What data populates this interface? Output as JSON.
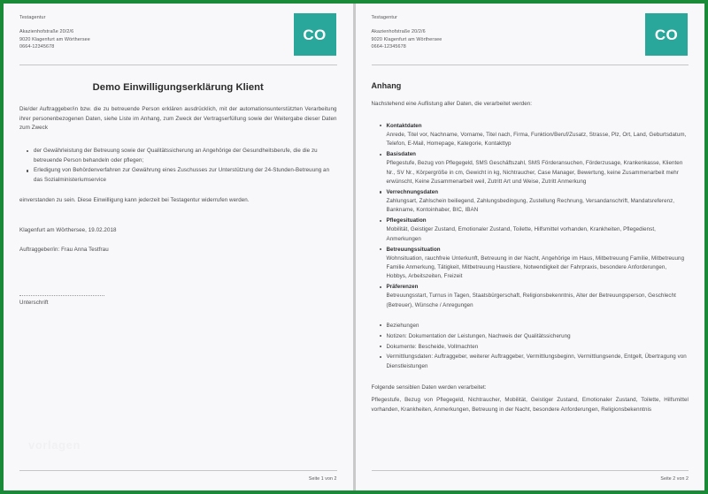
{
  "viewer": {
    "border_color": "#1b8a38",
    "page_background": "#f8f8fa",
    "accent_color": "#2aa79b"
  },
  "letterhead": {
    "company": "Testagentur",
    "street": "Akazienhofstraße 20/2/6",
    "city": "9020 Klagenfurt am Wörthersee",
    "phone": "0664-12345678",
    "logo_text": "CO"
  },
  "page1": {
    "title": "Demo Einwilligungserklärung Klient",
    "intro": "Die/der Auftraggeber/in bzw. die zu betreuende Person erklären ausdrücklich, mit der automationsunterstützten Verarbeitung ihrer personenbezogenen Daten, siehe Liste im Anhang, zum Zweck der Vertragserfüllung sowie der Weitergabe dieser Daten zum Zweck",
    "purposes": [
      "der Gewährleistung der Betreuung sowie der Qualitätssicherung an Angehörige der Gesundheitsberufe, die die zu betreuende Person behandeln oder pflegen;",
      "Erledigung von Behördenverfahren zur Gewährung eines Zuschusses zur Unterstützung der 24-Stunden-Betreuung an das Sozialministeriumservice"
    ],
    "closing": "einverstanden zu sein. Diese Einwilligung kann jederzeit bei Testagentur widerrufen werden.",
    "place_date": "Klagenfurt am Wörthersee, 19.02.2018",
    "client": "Auftraggeber/in: Frau Anna Testfrau",
    "signature_label": "Unterschrift",
    "watermark": "vorlagen",
    "footer": "Seite 1 von 2"
  },
  "page2": {
    "title": "Anhang",
    "intro": "Nachstehend eine Auflistung aller Daten, die verarbeitet werden:",
    "categories": [
      {
        "name": "Kontaktdaten",
        "fields": "Anrede, Titel vor, Nachname, Vorname, Titel nach, Firma, Funktion/Beruf/Zusatz, Strasse, Plz, Ort, Land, Geburtsdatum, Telefon, E-Mail, Homepage, Kategorie, Kontakttyp"
      },
      {
        "name": "Basisdaten",
        "fields": "Pflegestufe, Bezug von Pflegegeld, SMS Geschäftszahl, SMS Förderansuchen, Förderzusage, Krankenkasse, Klienten Nr., SV Nr., Körpergröße in cm, Gewicht in kg, Nichtraucher, Case Manager, Bewertung, keine Zusammenarbeit mehr erwünscht, Keine Zusammenarbeit weil, Zutritt Art und Weise, Zutritt Anmerkung"
      },
      {
        "name": "Verrechnungsdaten",
        "fields": "Zahlungsart, Zahlschein beiliegend, Zahlungsbedingung, Zustellung Rechnung, Versandanschrift, Mandatsreferenz, Bankname, Kontoinhaber, BIC, IBAN"
      },
      {
        "name": "Pflegesituation",
        "fields": "Mobilität, Geistiger Zustand, Emotionaler Zustand, Toilette, Hilfsmittel vorhanden, Krankheiten, Pflegedienst, Anmerkungen"
      },
      {
        "name": "Betreuungssituation",
        "fields": "Wohnsituation, rauchfreie Unterkunft, Betreuung in der Nacht, Angehörige im Haus, Mitbetreuung Familie, Mitbetreuung Familie Anmerkung, Tätigkeit, Mitbetreuung Haustiere, Notwendigkeit der Fahrpraxis, besondere Anforderungen, Hobbys, Arbeitszeiten, Freizeit"
      },
      {
        "name": "Präferenzen",
        "fields": "Betreuungsstart, Turnus in Tagen, Staatsbürgerschaft, Religionsbekenntnis, Alter der Betreuungsperson, Geschlecht (Betreuer), Wünsche / Anregungen"
      }
    ],
    "plain_items": [
      "Beziehungen",
      "Notizen: Dokumentation der Leistungen, Nachweis der Qualitätssicherung",
      "Dokumente: Bescheide, Vollmachten",
      "Vermittlungsdaten: Auftraggeber, weiterer Auftraggeber, Vermittlungsbeginn, Vermittlungsende, Entgelt, Übertragung von Dienstleistungen"
    ],
    "sensitive_heading": "Folgende sensiblen Daten werden verarbeitet:",
    "sensitive_body": "Pflegestufe, Bezug von Pflegegeld, Nichtraucher, Mobilität, Geistiger Zustand, Emotionaler Zustand, Toilette, Hilfsmittel vorhanden, Krankheiten, Anmerkungen, Betreuung in der Nacht, besondere Anforderungen, Religionsbekenntnis",
    "footer": "Seite 2 von 2"
  }
}
